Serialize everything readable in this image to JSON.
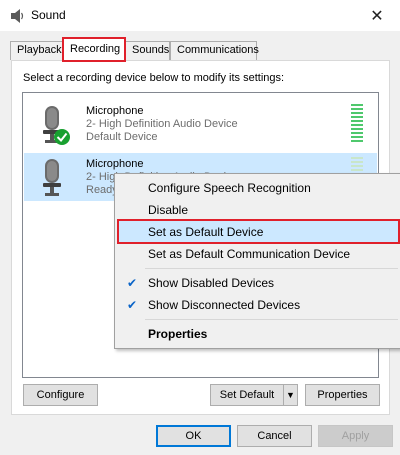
{
  "window": {
    "title": "Sound",
    "close_glyph": "✕"
  },
  "tabs": [
    {
      "label": "Playback",
      "active": false
    },
    {
      "label": "Recording",
      "active": true
    },
    {
      "label": "Sounds",
      "active": false
    },
    {
      "label": "Communications",
      "active": false
    }
  ],
  "panel": {
    "instruction": "Select a recording device below to modify its settings:"
  },
  "devices": [
    {
      "name": "Microphone",
      "driver": "2- High Definition Audio Device",
      "status": "Default Device",
      "is_default": true,
      "selected": false
    },
    {
      "name": "Microphone",
      "driver": "2- High Definition Audio Device",
      "status": "Ready",
      "is_default": false,
      "selected": true
    }
  ],
  "context_menu": {
    "items": [
      {
        "label": "Configure Speech Recognition",
        "checked": false
      },
      {
        "label": "Disable",
        "checked": false
      },
      {
        "label": "Set as Default Device",
        "checked": false,
        "hover": true
      },
      {
        "label": "Set as Default Communication Device",
        "checked": false
      },
      {
        "label": "Show Disabled Devices",
        "checked": true
      },
      {
        "label": "Show Disconnected Devices",
        "checked": true
      },
      {
        "label": "Properties",
        "checked": false,
        "bold": true
      }
    ]
  },
  "panel_buttons": {
    "configure": "Configure",
    "set_default": "Set Default",
    "set_default_arrow": "▼",
    "properties": "Properties"
  },
  "dialog_buttons": {
    "ok": "OK",
    "cancel": "Cancel",
    "apply": "Apply"
  },
  "colors": {
    "accent": "#0078d7",
    "highlight_red": "#e0202b",
    "selection": "#cce8ff",
    "check_green": "#18a030"
  }
}
